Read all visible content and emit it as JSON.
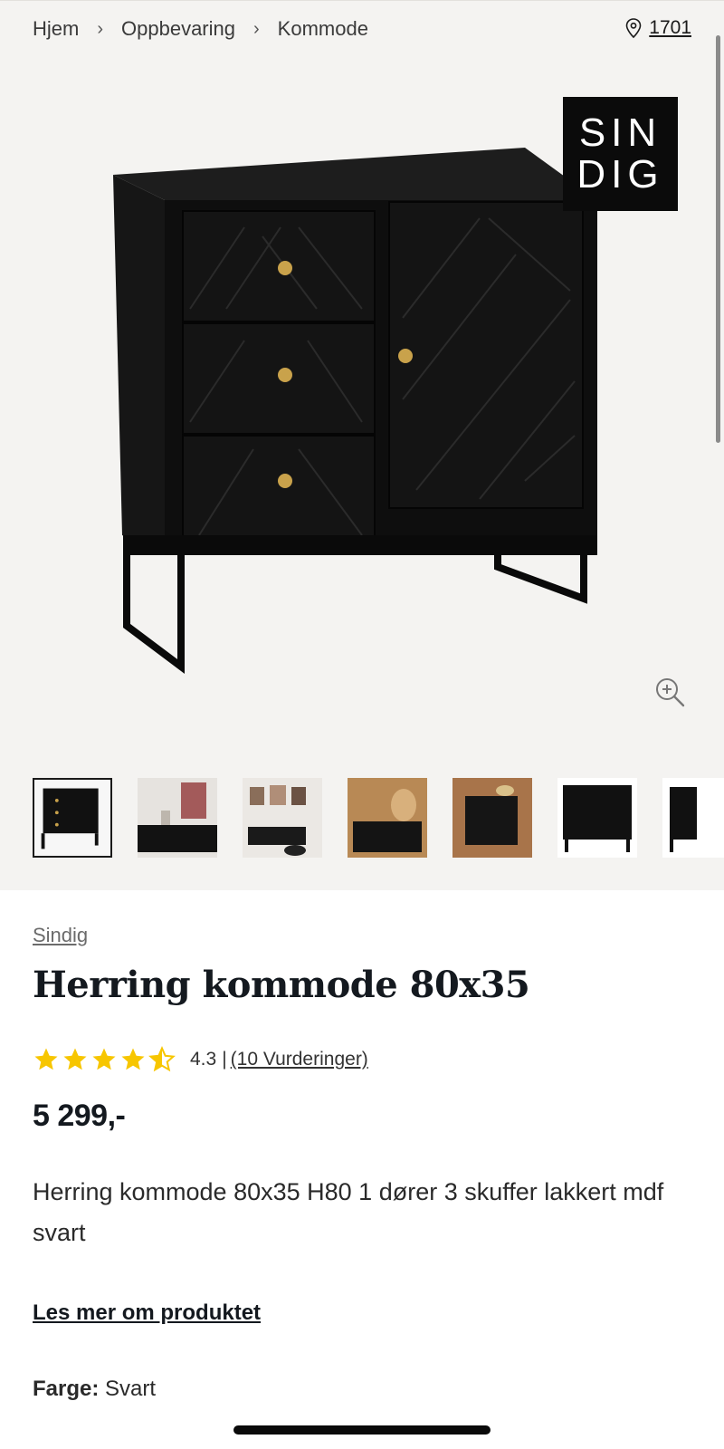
{
  "breadcrumb": [
    "Hjem",
    "Oppbevaring",
    "Kommode"
  ],
  "store": {
    "icon": "location-pin-icon",
    "number": "1701"
  },
  "hero": {
    "logo_lines": [
      "SIN",
      "DIG"
    ],
    "active_thumbnail_index": 0,
    "thumbnail_count": 7
  },
  "product": {
    "brand": "Sindig",
    "title": "Herring kommode 80x35",
    "rating": {
      "value": 4.5,
      "value_label": "4.3",
      "separator": "|",
      "count_label": "(10 Vurderinger)",
      "star_color": "#f7c600"
    },
    "price": "5 299,-",
    "description": "Herring kommode 80x35 H80 1 dører 3 skuffer lakkert mdf svart",
    "read_more": "Les mer om produktet",
    "color_label": "Farge:",
    "color_value": "Svart"
  }
}
